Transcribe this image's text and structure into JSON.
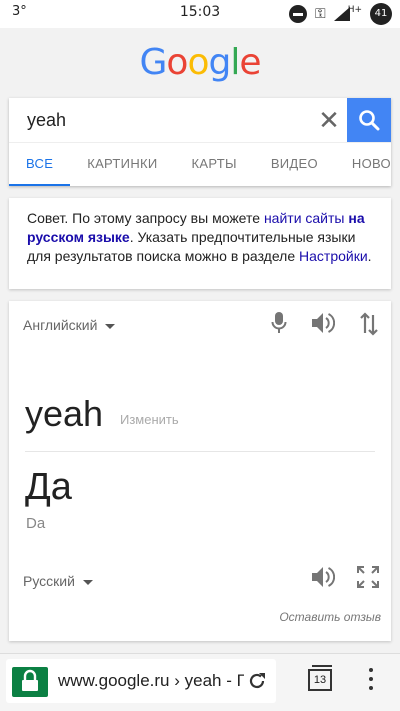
{
  "status_bar": {
    "temperature": "3°",
    "time": "15:03",
    "network": "H+",
    "battery": "41"
  },
  "logo": {
    "letters": [
      "G",
      "o",
      "o",
      "g",
      "l",
      "e"
    ],
    "colors": [
      "#4285f4",
      "#ea4335",
      "#fbbc05",
      "#4285f4",
      "#34a853",
      "#ea4335"
    ]
  },
  "search": {
    "query": "yeah",
    "clear_glyph": "✕"
  },
  "tabs": [
    {
      "label": "ВСЕ",
      "active": true
    },
    {
      "label": "КАРТИНКИ"
    },
    {
      "label": "КАРТЫ"
    },
    {
      "label": "ВИДЕО"
    },
    {
      "label": "НОВО"
    }
  ],
  "tip": {
    "prefix": "Совет. По этому запросу вы можете ",
    "link1": "найти сайты",
    "link_bold": "на русском языке",
    "middle": ". Указать предпочтительные языки для результатов поиска можно в разделе ",
    "link2": "Настройки",
    "suffix": "."
  },
  "translator": {
    "source_lang": "Английский",
    "source_text": "yeah",
    "edit_label": "Изменить",
    "translation": "Да",
    "transliteration": "Da",
    "target_lang": "Русский",
    "feedback": "Оставить отзыв"
  },
  "browser": {
    "url": "www.google.ru › yeah - Г",
    "tab_count": "13"
  },
  "colors": {
    "accent": "#4285f4",
    "active_tab": "#1a73e8",
    "link": "#1a0dab",
    "secure": "#0b8043"
  }
}
